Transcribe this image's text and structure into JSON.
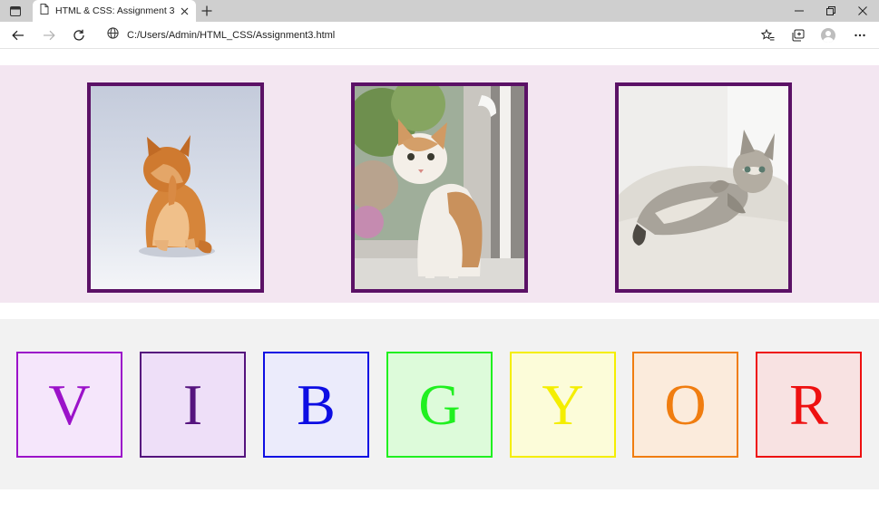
{
  "browser": {
    "tab_title": "HTML & CSS: Assignment 3",
    "address": "C:/Users/Admin/HTML_CSS/Assignment3.html"
  },
  "icons": {
    "tab_actions": "tab-actions-icon",
    "page": "page-icon",
    "close": "close-icon",
    "new_tab": "plus-icon",
    "minimize": "minimize-icon",
    "restore": "restore-icon",
    "window_close": "close-icon",
    "back": "back-arrow-icon",
    "forward": "forward-arrow-icon",
    "refresh": "refresh-icon",
    "site_info": "globe-icon",
    "favorites": "favorites-icon",
    "collections": "collections-icon",
    "profile": "profile-avatar",
    "more": "more-icon"
  },
  "gallery": {
    "background": "#f3e6f1",
    "border_color": "#5b1166",
    "photos": [
      {
        "name": "cat-photo-licking-paw"
      },
      {
        "name": "cat-photo-looking-up"
      },
      {
        "name": "cat-photo-lying-on-rug"
      }
    ]
  },
  "vibgyor": [
    {
      "letter": "V",
      "color": "#9b12c9",
      "fill": "#f5e6fb"
    },
    {
      "letter": "I",
      "color": "#55137e",
      "fill": "#eedff8"
    },
    {
      "letter": "B",
      "color": "#0d0de3",
      "fill": "#ebebfb"
    },
    {
      "letter": "G",
      "color": "#20f020",
      "fill": "#ddfbda"
    },
    {
      "letter": "Y",
      "color": "#f4ee00",
      "fill": "#fcfcd9"
    },
    {
      "letter": "O",
      "color": "#f07d10",
      "fill": "#fbebdc"
    },
    {
      "letter": "R",
      "color": "#ee1010",
      "fill": "#f8e2e2"
    }
  ]
}
